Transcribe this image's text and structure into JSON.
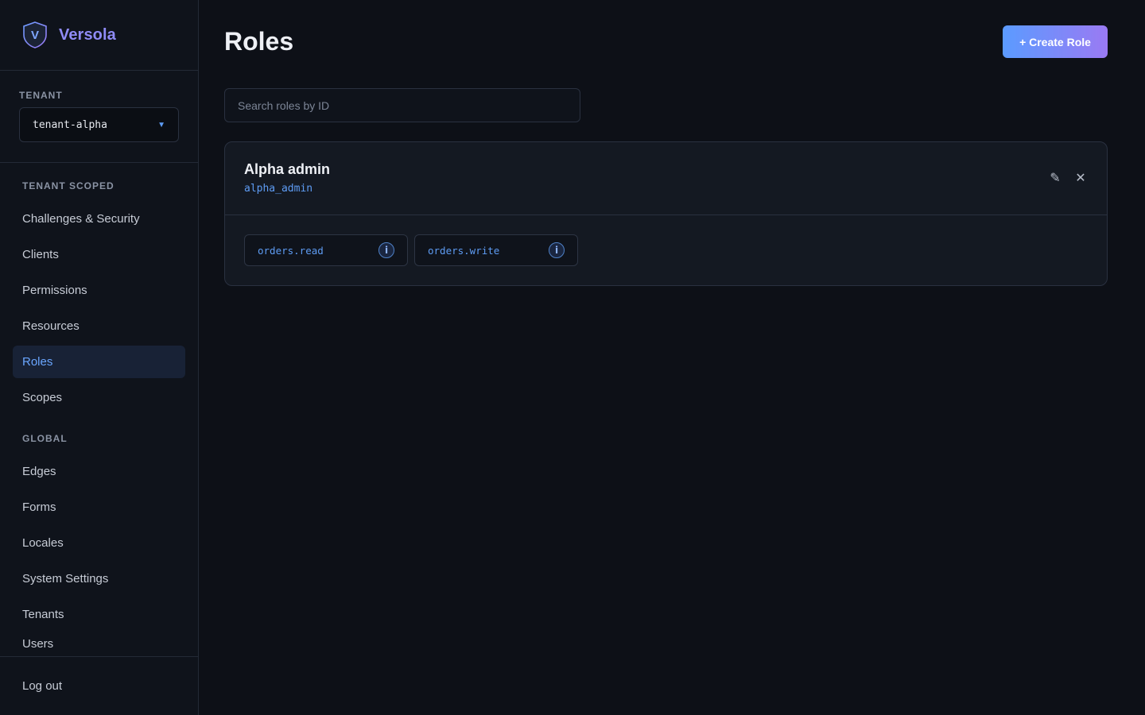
{
  "brand": {
    "logo_letter": "V",
    "name": "Versola"
  },
  "tenant": {
    "label": "TENANT",
    "selected": "tenant-alpha"
  },
  "nav": {
    "tenant_scoped_label": "TENANT SCOPED",
    "tenant_items": [
      "Challenges & Security",
      "Clients",
      "Permissions",
      "Resources",
      "Roles",
      "Scopes"
    ],
    "active_item": "Roles",
    "global_label": "GLOBAL",
    "global_items": [
      "Edges",
      "Forms",
      "Locales",
      "System Settings",
      "Tenants",
      "Users"
    ]
  },
  "logout_label": "Log out",
  "page": {
    "title": "Roles",
    "create_button": "+ Create Role",
    "search_placeholder": "Search roles by ID"
  },
  "roles": [
    {
      "name": "Alpha admin",
      "id": "alpha_admin",
      "permissions": [
        "orders.read",
        "orders.write"
      ]
    }
  ],
  "colors": {
    "accent": "#5e9cf4",
    "brand_gradient_start": "#5b9bff",
    "brand_gradient_end": "#9a7af3",
    "background": "#0d1017"
  }
}
